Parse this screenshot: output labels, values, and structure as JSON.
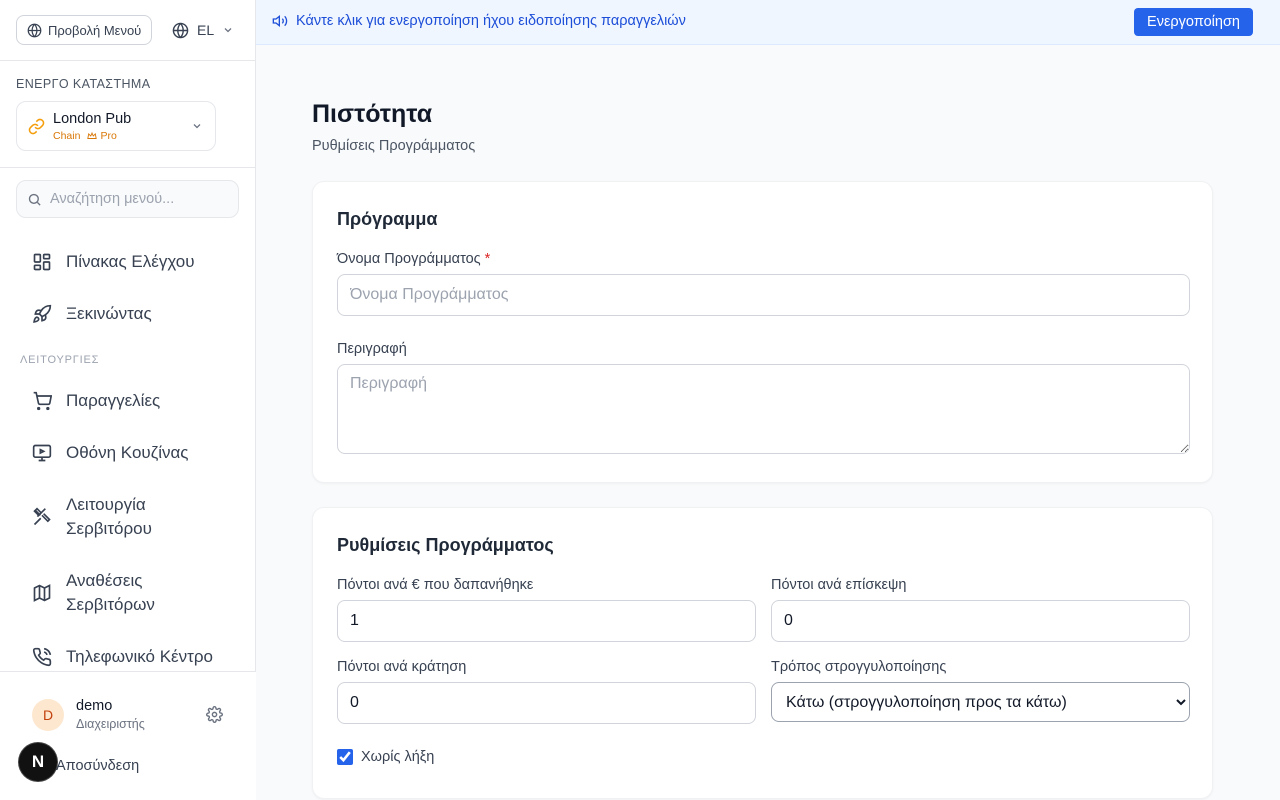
{
  "sidebar": {
    "menu_view_label": "Προβολή Μενού",
    "language": "EL",
    "active_store_heading": "ΕΝΕΡΓΟ ΚΑΤΑΣΤΗΜΑ",
    "store": {
      "name": "London Pub",
      "type": "Chain",
      "plan": "Pro"
    },
    "search_placeholder": "Αναζήτηση μενού...",
    "nav_top": [
      {
        "label": "Πίνακας Ελέγχου",
        "icon": "dashboard-icon"
      },
      {
        "label": "Ξεκινώντας",
        "icon": "rocket-icon"
      }
    ],
    "section_label": "ΛΕΙΤΟΥΡΓΙΕΣ",
    "nav_ops": [
      {
        "label": "Παραγγελίες",
        "icon": "cart-icon"
      },
      {
        "label": "Οθόνη Κουζίνας",
        "icon": "monitor-icon"
      },
      {
        "label_line1": "Λειτουργία",
        "label_line2": "Σερβιτόρου",
        "icon": "utensils-icon"
      },
      {
        "label_line1": "Αναθέσεις",
        "label_line2": "Σερβιτόρων",
        "icon": "map-icon"
      },
      {
        "label": "Τηλεφωνικό Κέντρο",
        "icon": "phone-icon"
      }
    ],
    "user": {
      "initial": "D",
      "name": "demo",
      "role": "Διαχειριστής"
    },
    "logout_label": "Αποσύνδεση",
    "badge_letter": "N"
  },
  "banner": {
    "text": "Κάντε κλικ για ενεργοποίηση ήχου ειδοποίησης παραγγελιών",
    "button_label": "Ενεργοποίηση"
  },
  "page": {
    "title": "Πιστότητα",
    "subtitle": "Ρυθμίσεις Προγράμματος"
  },
  "program_card": {
    "title": "Πρόγραμμα",
    "name_label": "Όνομα Προγράμματος",
    "required_mark": "*",
    "name_placeholder": "Όνομα Προγράμματος",
    "name_value": "",
    "description_label": "Περιγραφή",
    "description_placeholder": "Περιγραφή"
  },
  "settings_card": {
    "title": "Ρυθμίσεις Προγράμματος",
    "points_per_euro_label": "Πόντοι ανά € που δαπανήθηκε",
    "points_per_euro_value": "1",
    "points_per_visit_label": "Πόντοι ανά επίσκεψη",
    "points_per_visit_value": "0",
    "points_per_booking_label": "Πόντοι ανά κράτηση",
    "points_per_booking_value": "0",
    "rounding_label": "Τρόπος στρογγυλοποίησης",
    "rounding_selected": "Κάτω (στρογγυλοποίηση προς τα κάτω)",
    "no_expiry_label": "Χωρίς λήξη",
    "no_expiry_checked": true
  },
  "colors": {
    "accent": "#2563eb",
    "banner_bg": "#eff6ff",
    "banner_text": "#1d4ed8",
    "pro": "#d97706"
  }
}
